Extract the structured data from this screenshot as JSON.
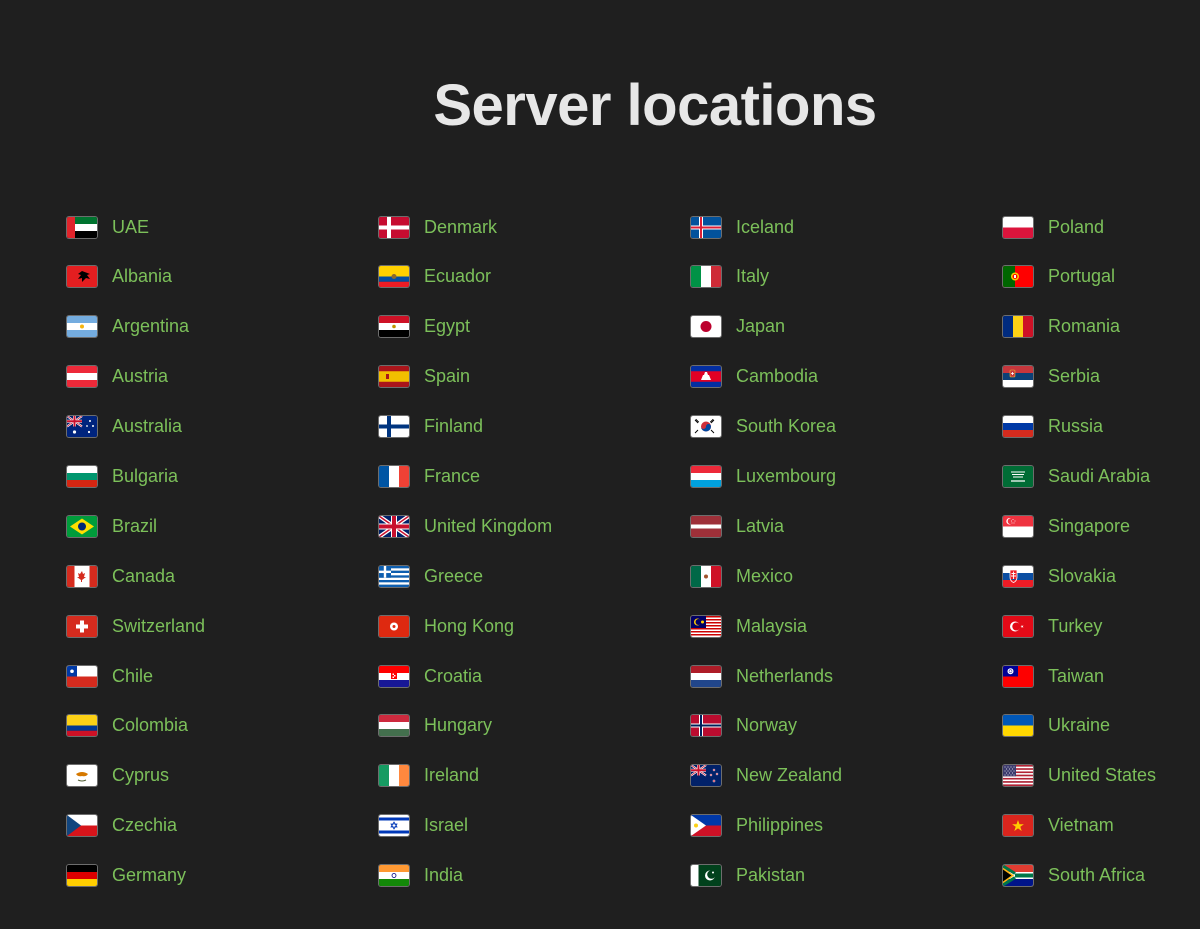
{
  "page": {
    "title": "Server locations",
    "accent_color": "#7cc05a",
    "background_color": "#1f1f1f",
    "title_color": "#e7e7e7"
  },
  "columns": [
    {
      "items": [
        {
          "name": "UAE",
          "flag": "ae"
        },
        {
          "name": "Albania",
          "flag": "al"
        },
        {
          "name": "Argentina",
          "flag": "ar"
        },
        {
          "name": "Austria",
          "flag": "at"
        },
        {
          "name": "Australia",
          "flag": "au"
        },
        {
          "name": "Bulgaria",
          "flag": "bg"
        },
        {
          "name": "Brazil",
          "flag": "br"
        },
        {
          "name": "Canada",
          "flag": "ca"
        },
        {
          "name": "Switzerland",
          "flag": "ch"
        },
        {
          "name": "Chile",
          "flag": "cl"
        },
        {
          "name": "Colombia",
          "flag": "co"
        },
        {
          "name": "Cyprus",
          "flag": "cy"
        },
        {
          "name": "Czechia",
          "flag": "cz"
        },
        {
          "name": "Germany",
          "flag": "de"
        }
      ]
    },
    {
      "items": [
        {
          "name": "Denmark",
          "flag": "dk"
        },
        {
          "name": "Ecuador",
          "flag": "ec"
        },
        {
          "name": "Egypt",
          "flag": "eg"
        },
        {
          "name": "Spain",
          "flag": "es"
        },
        {
          "name": "Finland",
          "flag": "fi"
        },
        {
          "name": "France",
          "flag": "fr"
        },
        {
          "name": "United Kingdom",
          "flag": "gb"
        },
        {
          "name": "Greece",
          "flag": "gr"
        },
        {
          "name": "Hong Kong",
          "flag": "hk"
        },
        {
          "name": "Croatia",
          "flag": "hr"
        },
        {
          "name": "Hungary",
          "flag": "hu"
        },
        {
          "name": "Ireland",
          "flag": "ie"
        },
        {
          "name": "Israel",
          "flag": "il"
        },
        {
          "name": "India",
          "flag": "in"
        }
      ]
    },
    {
      "items": [
        {
          "name": "Iceland",
          "flag": "is"
        },
        {
          "name": "Italy",
          "flag": "it"
        },
        {
          "name": "Japan",
          "flag": "jp"
        },
        {
          "name": "Cambodia",
          "flag": "kh"
        },
        {
          "name": "South Korea",
          "flag": "kr"
        },
        {
          "name": "Luxembourg",
          "flag": "lu"
        },
        {
          "name": "Latvia",
          "flag": "lv"
        },
        {
          "name": "Mexico",
          "flag": "mx"
        },
        {
          "name": "Malaysia",
          "flag": "my"
        },
        {
          "name": "Netherlands",
          "flag": "nl"
        },
        {
          "name": "Norway",
          "flag": "no"
        },
        {
          "name": "New Zealand",
          "flag": "nz"
        },
        {
          "name": "Philippines",
          "flag": "ph"
        },
        {
          "name": "Pakistan",
          "flag": "pk"
        }
      ]
    },
    {
      "items": [
        {
          "name": "Poland",
          "flag": "pl"
        },
        {
          "name": "Portugal",
          "flag": "pt"
        },
        {
          "name": "Romania",
          "flag": "ro"
        },
        {
          "name": "Serbia",
          "flag": "rs"
        },
        {
          "name": "Russia",
          "flag": "ru"
        },
        {
          "name": "Saudi Arabia",
          "flag": "sa"
        },
        {
          "name": "Singapore",
          "flag": "sg"
        },
        {
          "name": "Slovakia",
          "flag": "sk"
        },
        {
          "name": "Turkey",
          "flag": "tr"
        },
        {
          "name": "Taiwan",
          "flag": "tw"
        },
        {
          "name": "Ukraine",
          "flag": "ua"
        },
        {
          "name": "United States",
          "flag": "us"
        },
        {
          "name": "Vietnam",
          "flag": "vn"
        },
        {
          "name": "South Africa",
          "flag": "za"
        }
      ]
    }
  ]
}
